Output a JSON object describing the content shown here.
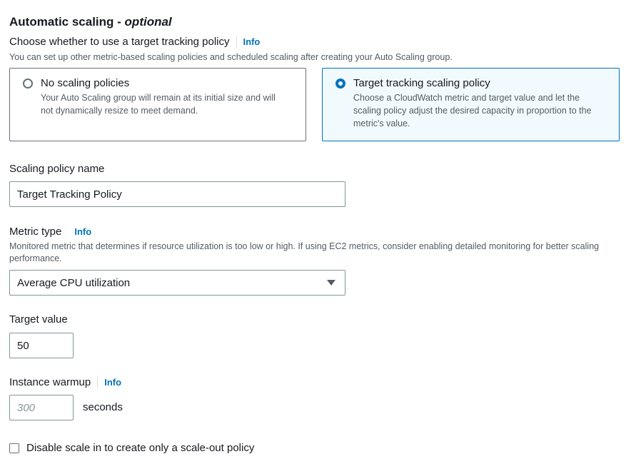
{
  "section": {
    "title": "Automatic scaling -",
    "title_optional": "optional"
  },
  "scaling_choice": {
    "label": "Choose whether to use a target tracking policy",
    "info": "Info",
    "description": "You can set up other metric-based scaling policies and scheduled scaling after creating your Auto Scaling group.",
    "options": [
      {
        "title": "No scaling policies",
        "description": "Your Auto Scaling group will remain at its initial size and will not dynamically resize to meet demand.",
        "selected": false
      },
      {
        "title": "Target tracking scaling policy",
        "description": "Choose a CloudWatch metric and target value and let the scaling policy adjust the desired capacity in proportion to the metric's value.",
        "selected": true
      }
    ]
  },
  "policy_name": {
    "label": "Scaling policy name",
    "value": "Target Tracking Policy"
  },
  "metric_type": {
    "label": "Metric type",
    "info": "Info",
    "description": "Monitored metric that determines if resource utilization is too low or high. If using EC2 metrics, consider enabling detailed monitoring for better scaling performance.",
    "selected": "Average CPU utilization"
  },
  "target_value": {
    "label": "Target value",
    "value": "50"
  },
  "instance_warmup": {
    "label": "Instance warmup",
    "info": "Info",
    "placeholder": "300",
    "unit": "seconds"
  },
  "disable_scale_in": {
    "label": "Disable scale in to create only a scale-out policy",
    "checked": false
  },
  "colors": {
    "link": "#0073bb",
    "selected_border": "#0073bb",
    "selected_bg": "#f1faff",
    "text": "#16191f",
    "secondary_text": "#545b64"
  }
}
